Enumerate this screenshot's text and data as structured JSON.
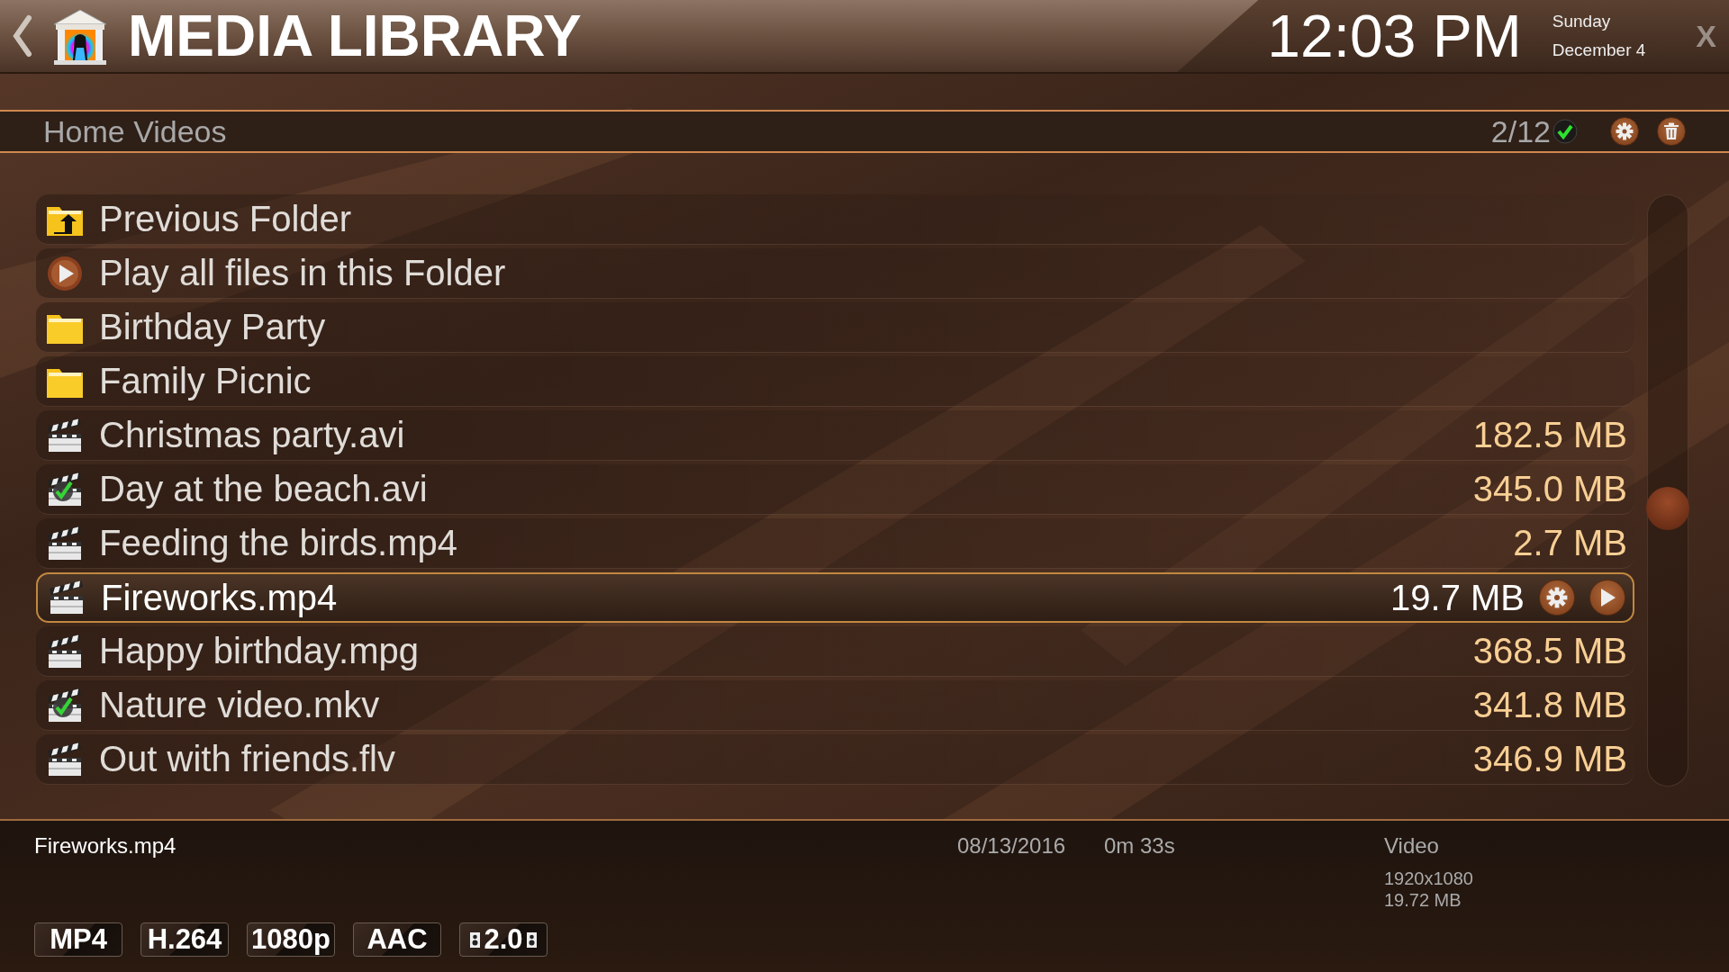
{
  "header": {
    "title": "MEDIA LIBRARY",
    "time": "12:03 PM",
    "day": "Sunday",
    "date": "December 4",
    "close": "X"
  },
  "breadcrumb": {
    "path": "Home Videos",
    "counter": "2/12"
  },
  "items": [
    {
      "kind": "parent",
      "name": "Previous Folder",
      "selected": false
    },
    {
      "kind": "play_all",
      "name": "Play all files in this Folder",
      "selected": false
    },
    {
      "kind": "folder",
      "name": "Birthday Party",
      "selected": false
    },
    {
      "kind": "folder",
      "name": "Family Picnic",
      "selected": false
    },
    {
      "kind": "video",
      "name": "Christmas party.avi",
      "size": "182.5 MB",
      "watched": false,
      "selected": false
    },
    {
      "kind": "video",
      "name": "Day at the beach.avi",
      "size": "345.0 MB",
      "watched": true,
      "selected": false
    },
    {
      "kind": "video",
      "name": "Feeding the birds.mp4",
      "size": "2.7 MB",
      "watched": false,
      "selected": false
    },
    {
      "kind": "video",
      "name": "Fireworks.mp4",
      "size": "19.7 MB",
      "watched": false,
      "selected": true
    },
    {
      "kind": "video",
      "name": "Happy birthday.mpg",
      "size": "368.5 MB",
      "watched": false,
      "selected": false
    },
    {
      "kind": "video",
      "name": "Nature video.mkv",
      "size": "341.8 MB",
      "watched": true,
      "selected": false
    },
    {
      "kind": "video",
      "name": "Out with friends.flv",
      "size": "346.9 MB",
      "watched": false,
      "selected": false
    }
  ],
  "details": {
    "filename": "Fireworks.mp4",
    "date": "08/13/2016",
    "duration": "0m 33s",
    "type": "Video",
    "resolution": "1920x1080",
    "filesize": "19.72 MB",
    "badges": [
      {
        "kind": "text",
        "label": "MP4"
      },
      {
        "kind": "text",
        "label": "H.264"
      },
      {
        "kind": "text",
        "label": "1080p"
      },
      {
        "kind": "text",
        "label": "AAC"
      },
      {
        "kind": "audio",
        "label": "2.0"
      }
    ]
  }
}
